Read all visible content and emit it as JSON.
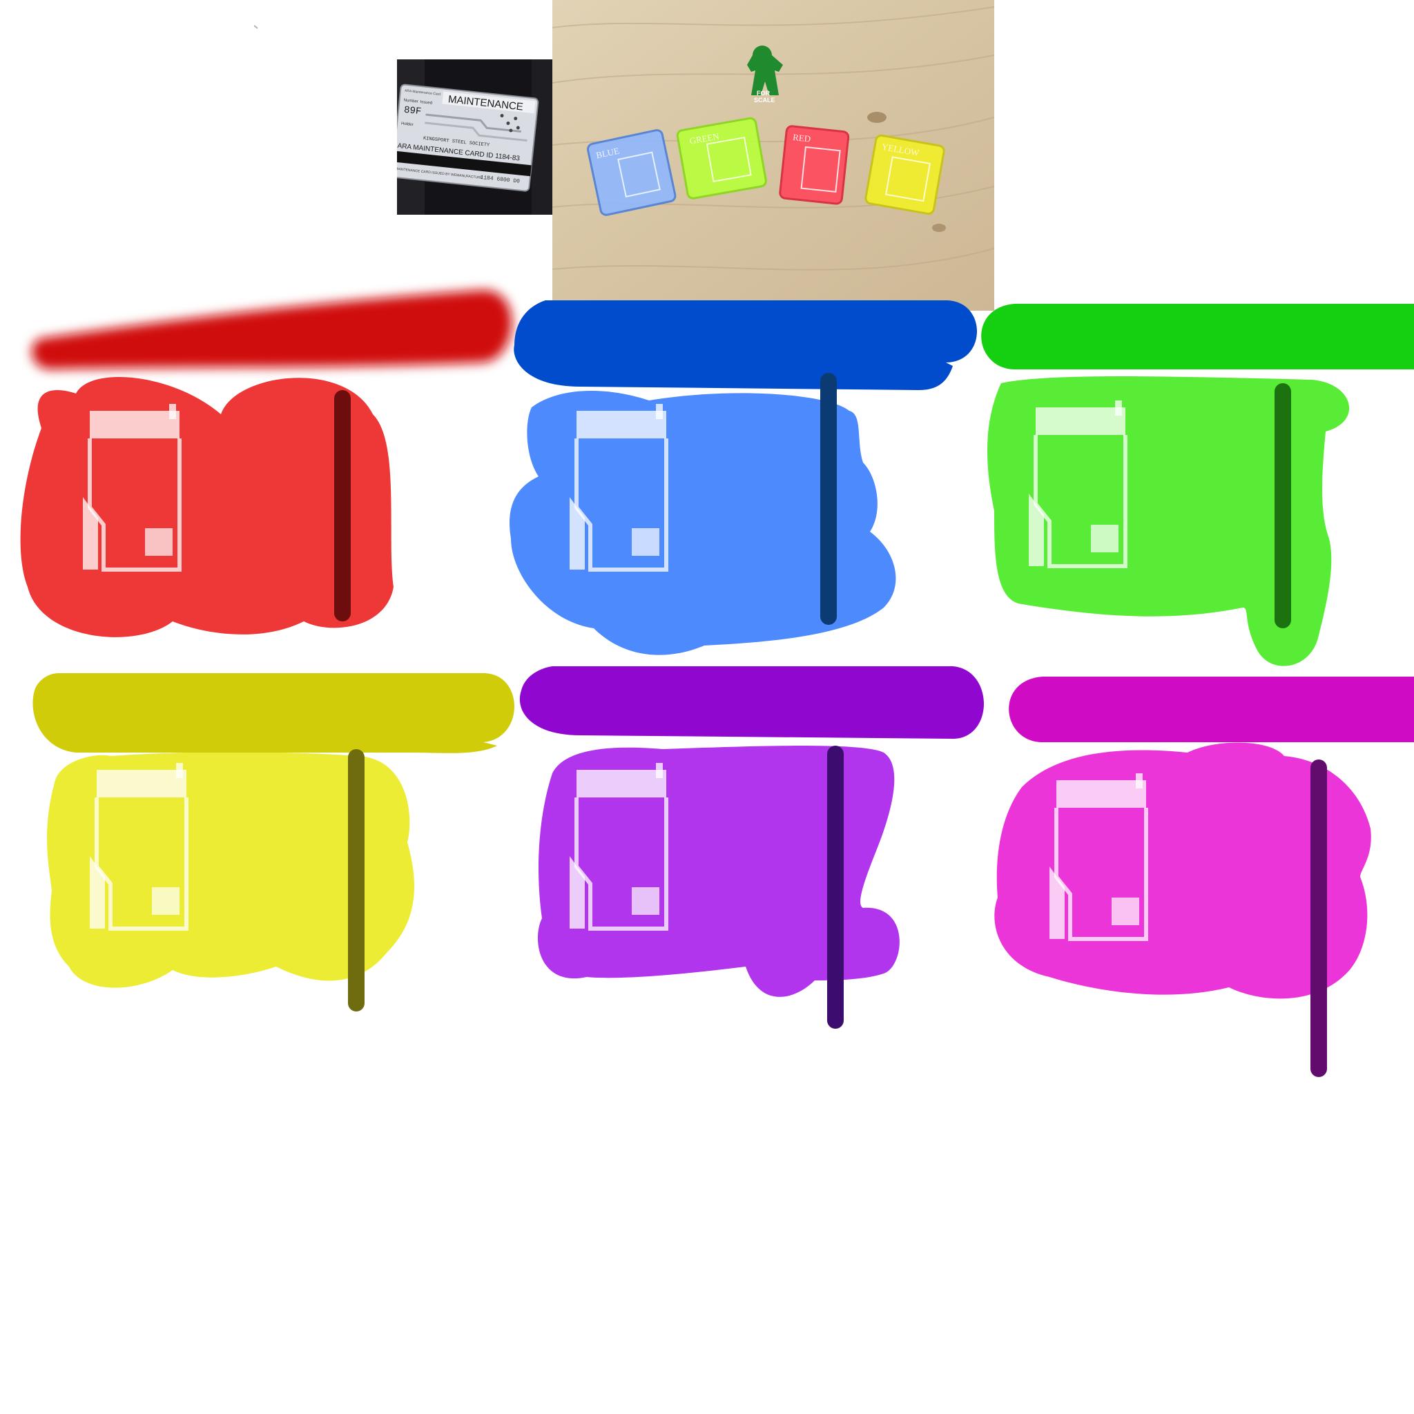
{
  "reference_card": {
    "small_text": "ARA Maintenance Card",
    "title": "MAINTENANCE",
    "field_number_label": "Number",
    "field_issued_label": "Issued",
    "number": "89F",
    "field_holder_label": "Holder",
    "holder_line": "KINGSPORT STEEL SOCIETY",
    "card_id_line": "ARA MAINTENANCE CARD ID 1184-83",
    "footer_line": "MAINTENANCE CARD ISSUED BY WEMANUFACTURE",
    "footer_code": "1184 6800 D0"
  },
  "photo": {
    "meeple_text_line1": "FOR",
    "meeple_text_line2": "SCALE",
    "card_labels": [
      "BLUE",
      "GREEN",
      "RED",
      "YELLOW"
    ],
    "colors": {
      "wood": "#d9c8a8",
      "meeple": "#1f8a2e",
      "blue_card": "#8fb8ff",
      "green_card": "#b8ff3a",
      "red_card": "#ff4a5c",
      "yellow_card": "#f2ee2a"
    }
  },
  "tiles": [
    {
      "color_name": "red",
      "blob": "#ee3838",
      "bar": "#d00d09",
      "post": "#6e0d0d",
      "icon": "key-card-icon"
    },
    {
      "color_name": "blue",
      "blob": "#4c8afd",
      "bar": "#004ccc",
      "post": "#0b3b72",
      "icon": "key-card-icon"
    },
    {
      "color_name": "green",
      "blob": "#58ec36",
      "bar": "#14d010",
      "post": "#1c720e",
      "icon": "key-card-icon"
    },
    {
      "color_name": "yellow",
      "blob": "#ecec34",
      "bar": "#d0cc0a",
      "post": "#6e6c0e",
      "icon": "key-card-icon"
    },
    {
      "color_name": "purple",
      "blob": "#b035ec",
      "bar": "#9008d0",
      "post": "#3c0c6e",
      "icon": "key-card-icon"
    },
    {
      "color_name": "magenta",
      "blob": "#ec35d8",
      "bar": "#d00bc4",
      "post": "#620c6e",
      "icon": "key-card-icon"
    }
  ]
}
